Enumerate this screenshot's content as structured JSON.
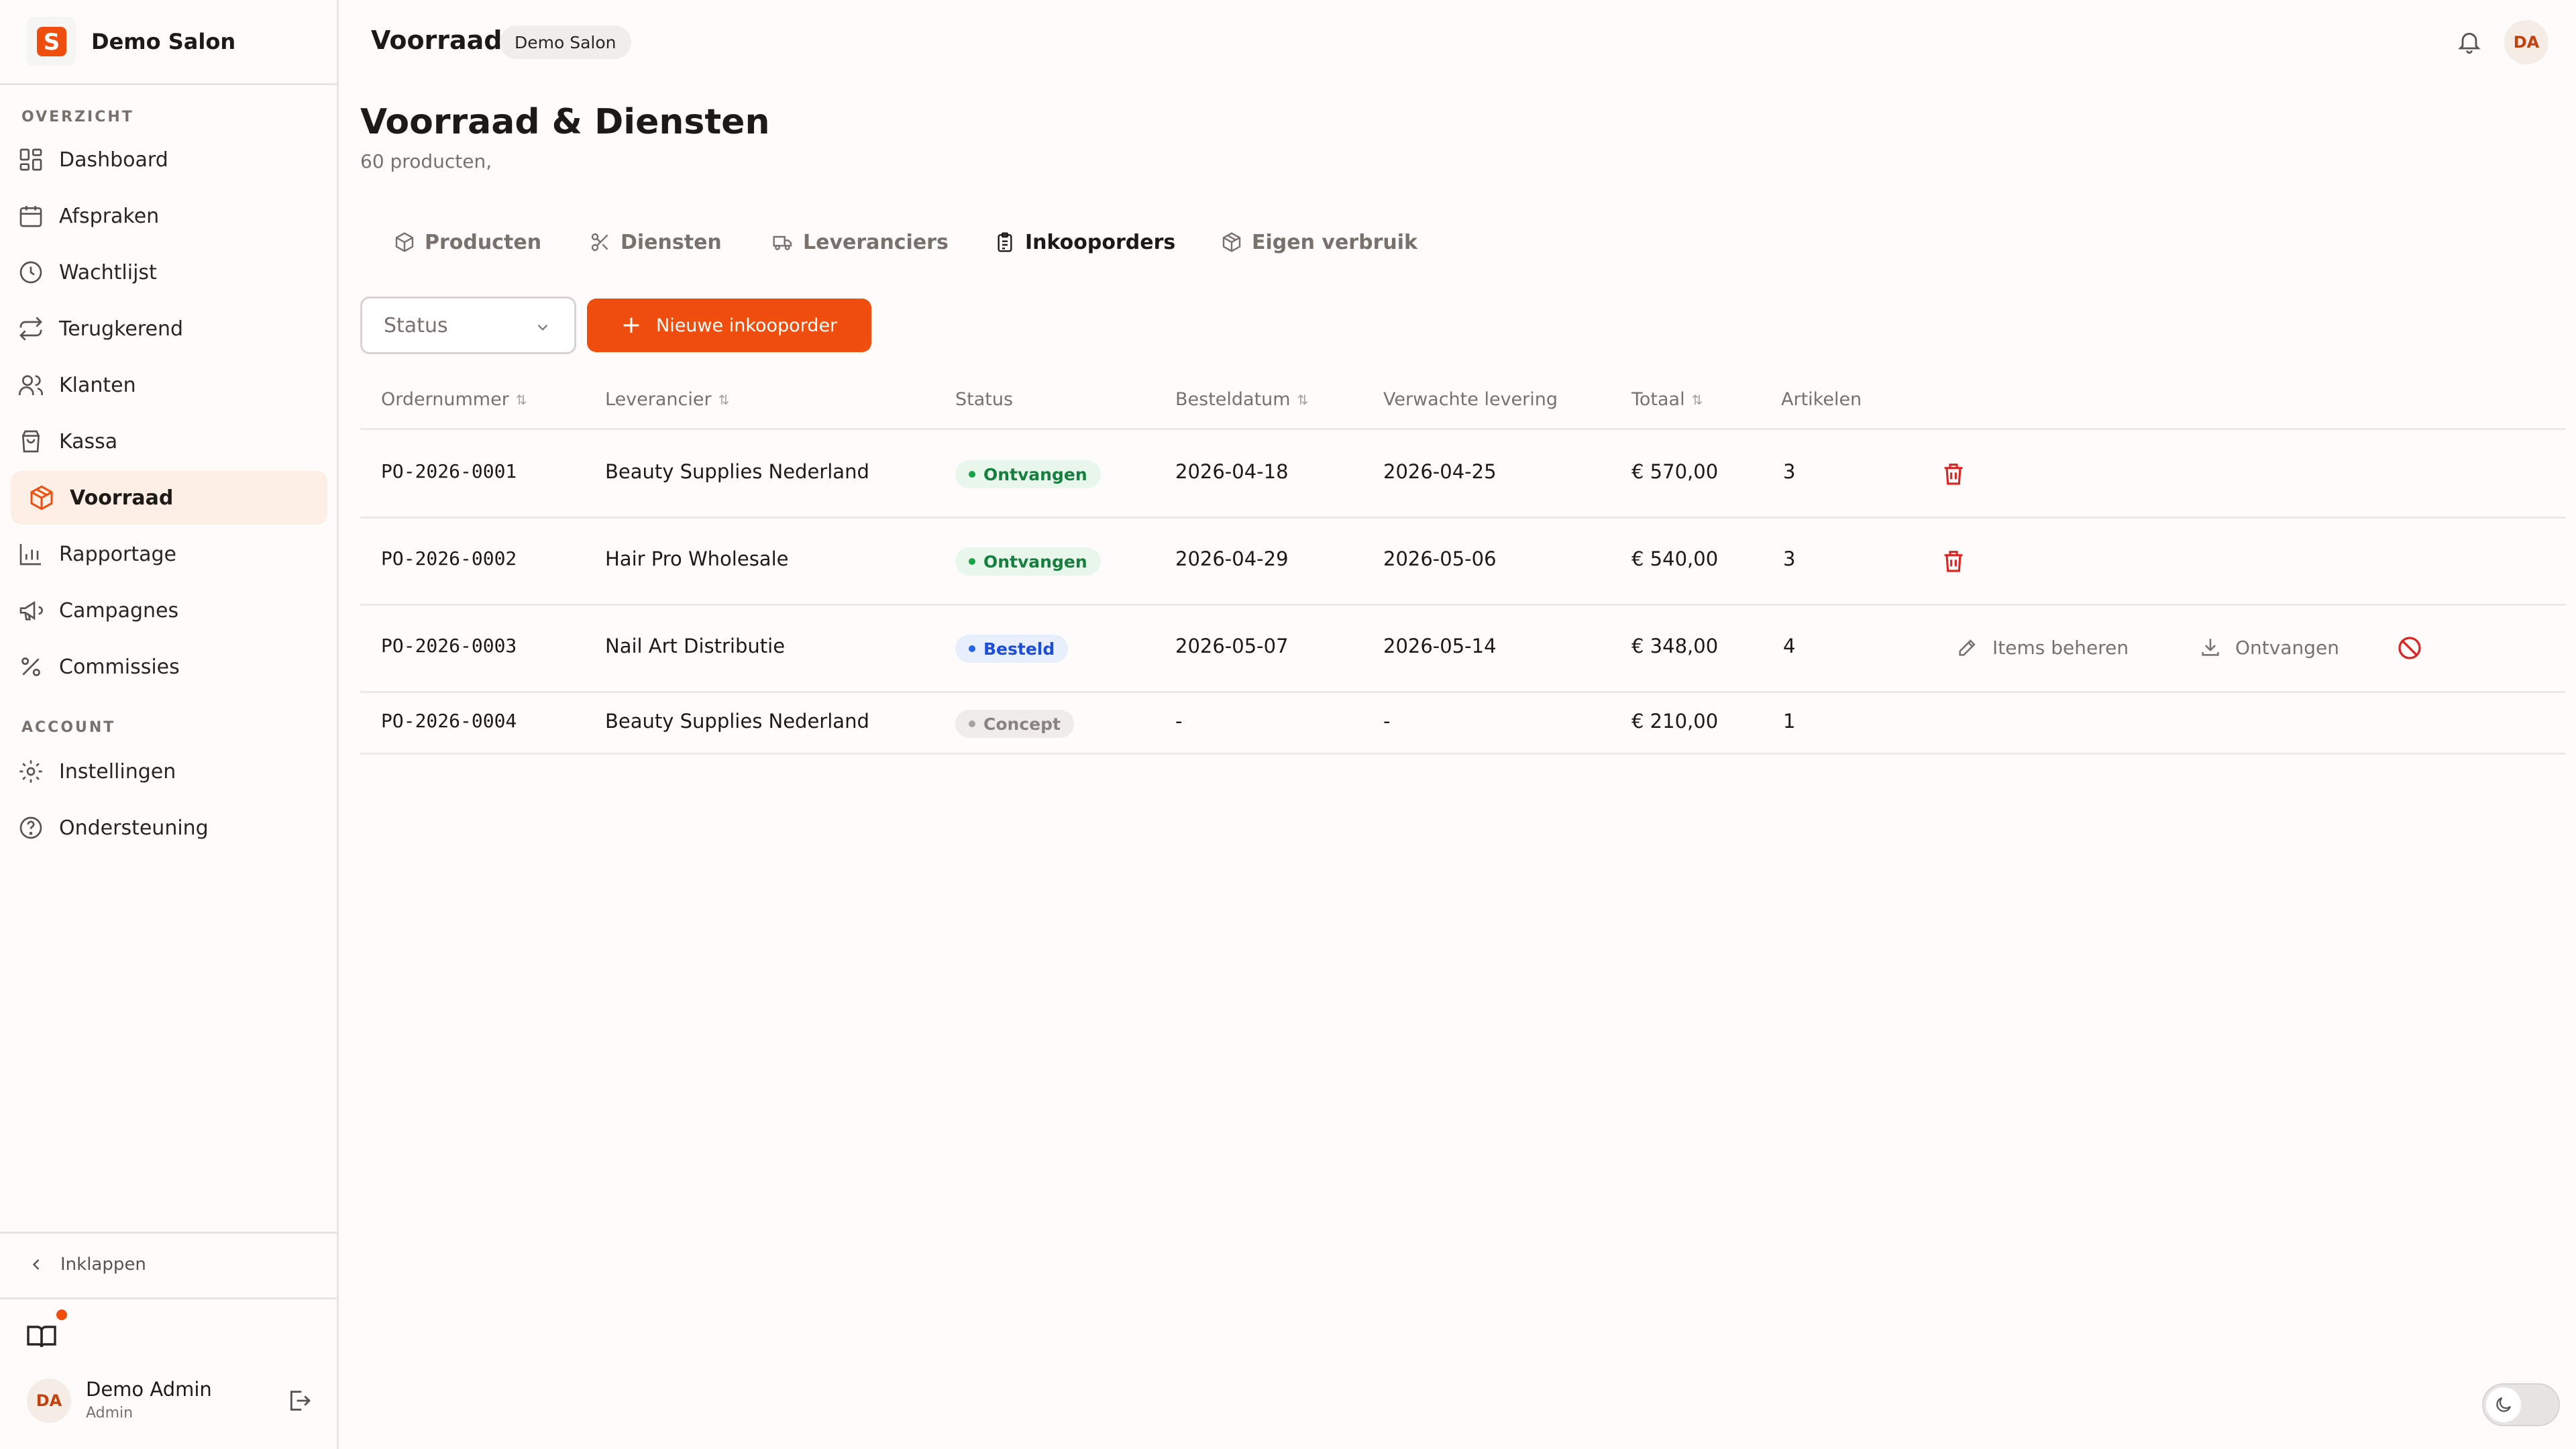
{
  "brand": {
    "name": "Demo Salon",
    "logo_letter": "S"
  },
  "nav": {
    "section_overview": "OVERZICHT",
    "section_account": "ACCOUNT",
    "items": [
      {
        "label": "Dashboard",
        "icon": "dashboard-icon"
      },
      {
        "label": "Afspraken",
        "icon": "calendar-icon"
      },
      {
        "label": "Wachtlijst",
        "icon": "clock-icon"
      },
      {
        "label": "Terugkerend",
        "icon": "repeat-icon"
      },
      {
        "label": "Klanten",
        "icon": "users-icon"
      },
      {
        "label": "Kassa",
        "icon": "shopping-bag-icon"
      },
      {
        "label": "Voorraad",
        "icon": "package-icon",
        "active": true
      },
      {
        "label": "Rapportage",
        "icon": "bar-chart-icon"
      },
      {
        "label": "Campagnes",
        "icon": "megaphone-icon"
      },
      {
        "label": "Commissies",
        "icon": "percent-icon"
      }
    ],
    "account_items": [
      {
        "label": "Instellingen",
        "icon": "gear-icon"
      },
      {
        "label": "Ondersteuning",
        "icon": "help-circle-icon"
      }
    ],
    "collapse_label": "Inklappen"
  },
  "user": {
    "initials": "DA",
    "name": "Demo Admin",
    "role": "Admin"
  },
  "topbar": {
    "title": "Voorraad",
    "badge": "Demo Salon",
    "avatar": "DA"
  },
  "page": {
    "title": "Voorraad & Diensten",
    "subtitle": "60 producten,"
  },
  "tabs": [
    {
      "label": "Producten",
      "icon": "box-icon"
    },
    {
      "label": "Diensten",
      "icon": "scissors-icon"
    },
    {
      "label": "Leveranciers",
      "icon": "truck-icon"
    },
    {
      "label": "Inkooporders",
      "icon": "clipboard-icon",
      "active": true
    },
    {
      "label": "Eigen verbruik",
      "icon": "box-icon"
    }
  ],
  "filters": {
    "status_placeholder": "Status",
    "new_button": "Nieuwe inkooporder"
  },
  "table": {
    "headers": {
      "order": "Ordernummer",
      "supplier": "Leverancier",
      "status": "Status",
      "ordered": "Besteldatum",
      "expected": "Verwachte levering",
      "total": "Totaal",
      "items": "Artikelen"
    },
    "rows": [
      {
        "order": "PO-2026-0001",
        "supplier": "Beauty Supplies Nederland",
        "status": "Ontvangen",
        "ordered": "2026-04-18",
        "expected": "2026-04-25",
        "total": "€ 570,00",
        "items": "3"
      },
      {
        "order": "PO-2026-0002",
        "supplier": "Hair Pro Wholesale",
        "status": "Ontvangen",
        "ordered": "2026-04-29",
        "expected": "2026-05-06",
        "total": "€ 540,00",
        "items": "3"
      },
      {
        "order": "PO-2026-0003",
        "supplier": "Nail Art Distributie",
        "status": "Besteld",
        "ordered": "2026-05-07",
        "expected": "2026-05-14",
        "total": "€ 348,00",
        "items": "4"
      },
      {
        "order": "PO-2026-0004",
        "supplier": "Beauty Supplies Nederland",
        "status": "Concept",
        "ordered": "-",
        "expected": "-",
        "total": "€ 210,00",
        "items": "1"
      }
    ],
    "actions": {
      "manage_items": "Items beheren",
      "receive": "Ontvangen"
    }
  },
  "colors": {
    "accent": "#f04e0e",
    "received": "#15803d",
    "ordered": "#1d4ed8",
    "draft": "#8a8380",
    "delete": "#dc2626"
  }
}
